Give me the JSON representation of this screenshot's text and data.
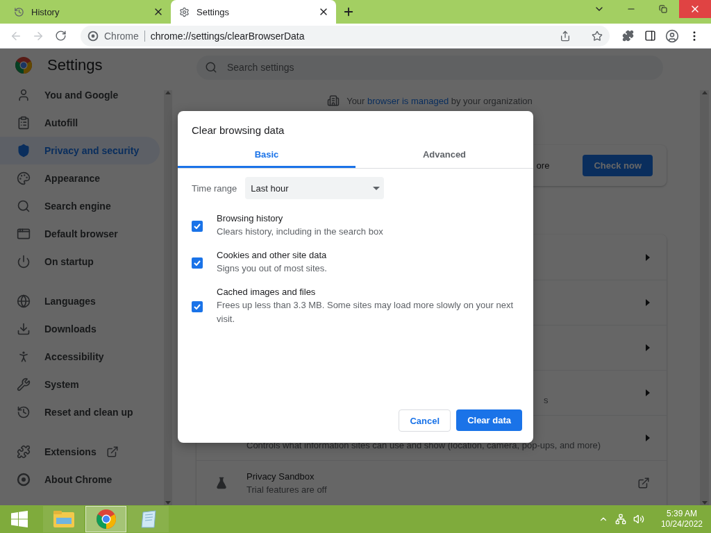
{
  "tabs": [
    {
      "title": "History",
      "kind": "history",
      "selected": false
    },
    {
      "title": "Settings",
      "kind": "settings",
      "selected": true
    }
  ],
  "toolbar": {
    "back_enabled": false,
    "forward_enabled": false,
    "origin": "Chrome",
    "url": "chrome://settings/clearBrowserData"
  },
  "sidebar": {
    "title": "Settings",
    "groups": [
      [
        {
          "label": "You and Google",
          "kind": "person",
          "selected": false
        },
        {
          "label": "Autofill",
          "kind": "autofill",
          "selected": false
        },
        {
          "label": "Privacy and security",
          "kind": "shield",
          "selected": true
        },
        {
          "label": "Appearance",
          "kind": "palette",
          "selected": false
        },
        {
          "label": "Search engine",
          "kind": "search",
          "selected": false
        },
        {
          "label": "Default browser",
          "kind": "browser",
          "selected": false
        },
        {
          "label": "On startup",
          "kind": "power",
          "selected": false
        }
      ],
      [
        {
          "label": "Languages",
          "kind": "globe",
          "selected": false
        },
        {
          "label": "Downloads",
          "kind": "download",
          "selected": false
        },
        {
          "label": "Accessibility",
          "kind": "accessibility",
          "selected": false
        },
        {
          "label": "System",
          "kind": "wrench",
          "selected": false
        },
        {
          "label": "Reset and clean up",
          "kind": "restore",
          "selected": false
        }
      ],
      [
        {
          "label": "Extensions",
          "kind": "puzzle",
          "selected": false,
          "external": true
        },
        {
          "label": "About Chrome",
          "kind": "chrome",
          "selected": false
        }
      ]
    ]
  },
  "main": {
    "search": {
      "placeholder": "Search settings"
    },
    "managed_notice": {
      "before": "Your",
      "link": "browser is managed",
      "after": "by your organization"
    },
    "safety_check": {
      "fragment": "ore",
      "button": "Check now"
    },
    "rows": [
      {
        "kind": "arrow"
      },
      {
        "kind": "arrow"
      },
      {
        "kind": "arrow"
      },
      {
        "kind": "arrow",
        "fragment": "s"
      },
      {
        "kind": "arrow",
        "subtitle": "Controls what information sites can use and show (location, camera, pop-ups, and more)"
      },
      {
        "kind": "external",
        "title": "Privacy Sandbox",
        "subtitle": "Trial features are off"
      }
    ]
  },
  "dialog": {
    "title": "Clear browsing data",
    "tabs": [
      {
        "label": "Basic",
        "selected": true
      },
      {
        "label": "Advanced",
        "selected": false
      }
    ],
    "time_range": {
      "label": "Time range",
      "value": "Last hour"
    },
    "items": [
      {
        "title": "Browsing history",
        "subtitle": "Clears history, including in the search box",
        "checked": true
      },
      {
        "title": "Cookies and other site data",
        "subtitle": "Signs you out of most sites.",
        "checked": true
      },
      {
        "title": "Cached images and files",
        "subtitle": "Frees up less than 3.3 MB. Some sites may load more slowly on your next visit.",
        "checked": true
      }
    ],
    "buttons": {
      "cancel": "Cancel",
      "confirm": "Clear data"
    }
  },
  "taskbar": {
    "apps": [
      {
        "kind": "explorer",
        "selected": false
      },
      {
        "kind": "chrome",
        "selected": true
      },
      {
        "kind": "notepad",
        "selected": false
      }
    ],
    "time": "5:39 AM",
    "date": "10/24/2022"
  }
}
